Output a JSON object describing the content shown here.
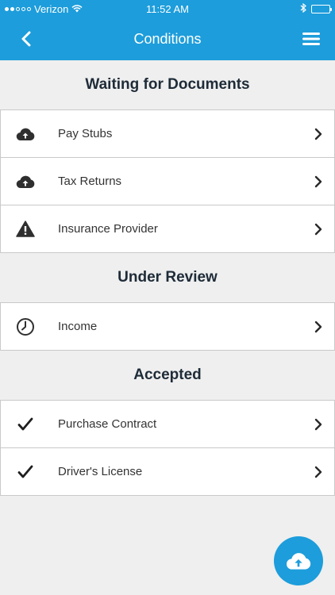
{
  "status_bar": {
    "carrier": "Verizon",
    "time": "11:52 AM"
  },
  "header": {
    "title": "Conditions"
  },
  "sections": [
    {
      "title": "Waiting for Documents",
      "items": [
        {
          "label": "Pay Stubs",
          "icon": "cloud-upload-icon"
        },
        {
          "label": "Tax Returns",
          "icon": "cloud-upload-icon"
        },
        {
          "label": "Insurance Provider",
          "icon": "warning-icon"
        }
      ]
    },
    {
      "title": "Under Review",
      "items": [
        {
          "label": "Income",
          "icon": "clock-icon"
        }
      ]
    },
    {
      "title": "Accepted",
      "items": [
        {
          "label": "Purchase Contract",
          "icon": "checkmark-icon"
        },
        {
          "label": "Driver's License",
          "icon": "checkmark-icon"
        }
      ]
    }
  ],
  "colors": {
    "accent": "#1d9ddb",
    "background": "#efefef",
    "heading": "#1e2b38"
  }
}
